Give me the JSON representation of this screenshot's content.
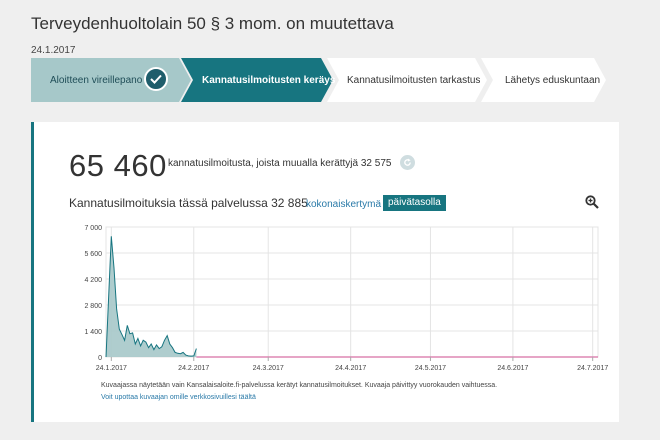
{
  "page": {
    "title": "Terveydenhuoltolain 50 § 3 mom. on muutettava",
    "date": "24.1.2017"
  },
  "steps": [
    {
      "label": "Aloitteen vireillepano",
      "state": "done"
    },
    {
      "label": "Kannatusilmoitusten keräys",
      "state": "active"
    },
    {
      "label": "Kannatusilmoitusten tarkastus",
      "state": "upcoming"
    },
    {
      "label": "Lähetys eduskuntaan",
      "state": "upcoming"
    }
  ],
  "summary": {
    "total": "65 460",
    "text": "kannatusilmoitusta, joista muualla kerättyjä 32 575"
  },
  "chart_header": {
    "title": "Kannatusilmoituksia tässä palvelussa 32 885",
    "link_total": "kokonaiskertymä",
    "button_daily": "päivätasolla"
  },
  "chart_data": {
    "type": "area",
    "title": "",
    "xlabel": "",
    "ylabel": "",
    "ylim": [
      0,
      7000
    ],
    "yticks": [
      0,
      1400,
      2800,
      4200,
      5600,
      7000
    ],
    "ytick_labels": [
      "0",
      "1 400",
      "2 800",
      "4 200",
      "5 600",
      "7 000"
    ],
    "xlim": [
      "2017-01-22",
      "2017-07-26"
    ],
    "xticks": [
      "2017-01-24",
      "2017-02-24",
      "2017-03-24",
      "2017-04-24",
      "2017-05-24",
      "2017-06-24",
      "2017-07-24"
    ],
    "xtick_labels": [
      "24.1.2017",
      "24.2.2017",
      "24.3.2017",
      "24.4.2017",
      "24.5.2017",
      "24.6.2017",
      "24.7.2017"
    ],
    "series": [
      {
        "color": "#177580",
        "fill": "#a6c8c9",
        "points": [
          [
            "2017-01-22",
            0
          ],
          [
            "2017-01-24",
            6500
          ],
          [
            "2017-01-25",
            4800
          ],
          [
            "2017-01-26",
            2600
          ],
          [
            "2017-01-27",
            1500
          ],
          [
            "2017-01-28",
            1200
          ],
          [
            "2017-01-29",
            900
          ],
          [
            "2017-01-30",
            1700
          ],
          [
            "2017-01-31",
            1250
          ],
          [
            "2017-02-01",
            1300
          ],
          [
            "2017-02-02",
            700
          ],
          [
            "2017-02-03",
            1000
          ],
          [
            "2017-02-04",
            600
          ],
          [
            "2017-02-05",
            900
          ],
          [
            "2017-02-06",
            800
          ],
          [
            "2017-02-07",
            500
          ],
          [
            "2017-02-08",
            700
          ],
          [
            "2017-02-09",
            400
          ],
          [
            "2017-02-10",
            650
          ],
          [
            "2017-02-11",
            450
          ],
          [
            "2017-02-12",
            550
          ],
          [
            "2017-02-13",
            900
          ],
          [
            "2017-02-14",
            1150
          ],
          [
            "2017-02-15",
            700
          ],
          [
            "2017-02-16",
            500
          ],
          [
            "2017-02-17",
            250
          ],
          [
            "2017-02-18",
            200
          ],
          [
            "2017-02-19",
            180
          ],
          [
            "2017-02-20",
            250
          ],
          [
            "2017-02-21",
            100
          ],
          [
            "2017-02-22",
            60
          ],
          [
            "2017-02-23",
            50
          ],
          [
            "2017-02-24",
            60
          ],
          [
            "2017-02-25",
            450
          ]
        ]
      },
      {
        "color": "#d66fa4",
        "points": [
          [
            "2017-02-25",
            0
          ],
          [
            "2017-07-26",
            0
          ]
        ]
      }
    ],
    "grid": true
  },
  "footer": {
    "note": "Kuvaajassa näytetään vain Kansalaisaloite.fi-palvelussa kerätyt kannatusilmoitukset. Kuvaaja päivittyy vuorokauden vaihtuessa.",
    "embed_link": "Voit upottaa kuvaajan omille verkkosivuillesi täältä"
  },
  "colors": {
    "accent": "#177580",
    "done_step": "#a6c8c9",
    "upcoming_step": "#ffffff"
  },
  "icons": {
    "check": "check-icon",
    "refresh": "refresh-icon",
    "zoom": "zoom-in-icon"
  }
}
